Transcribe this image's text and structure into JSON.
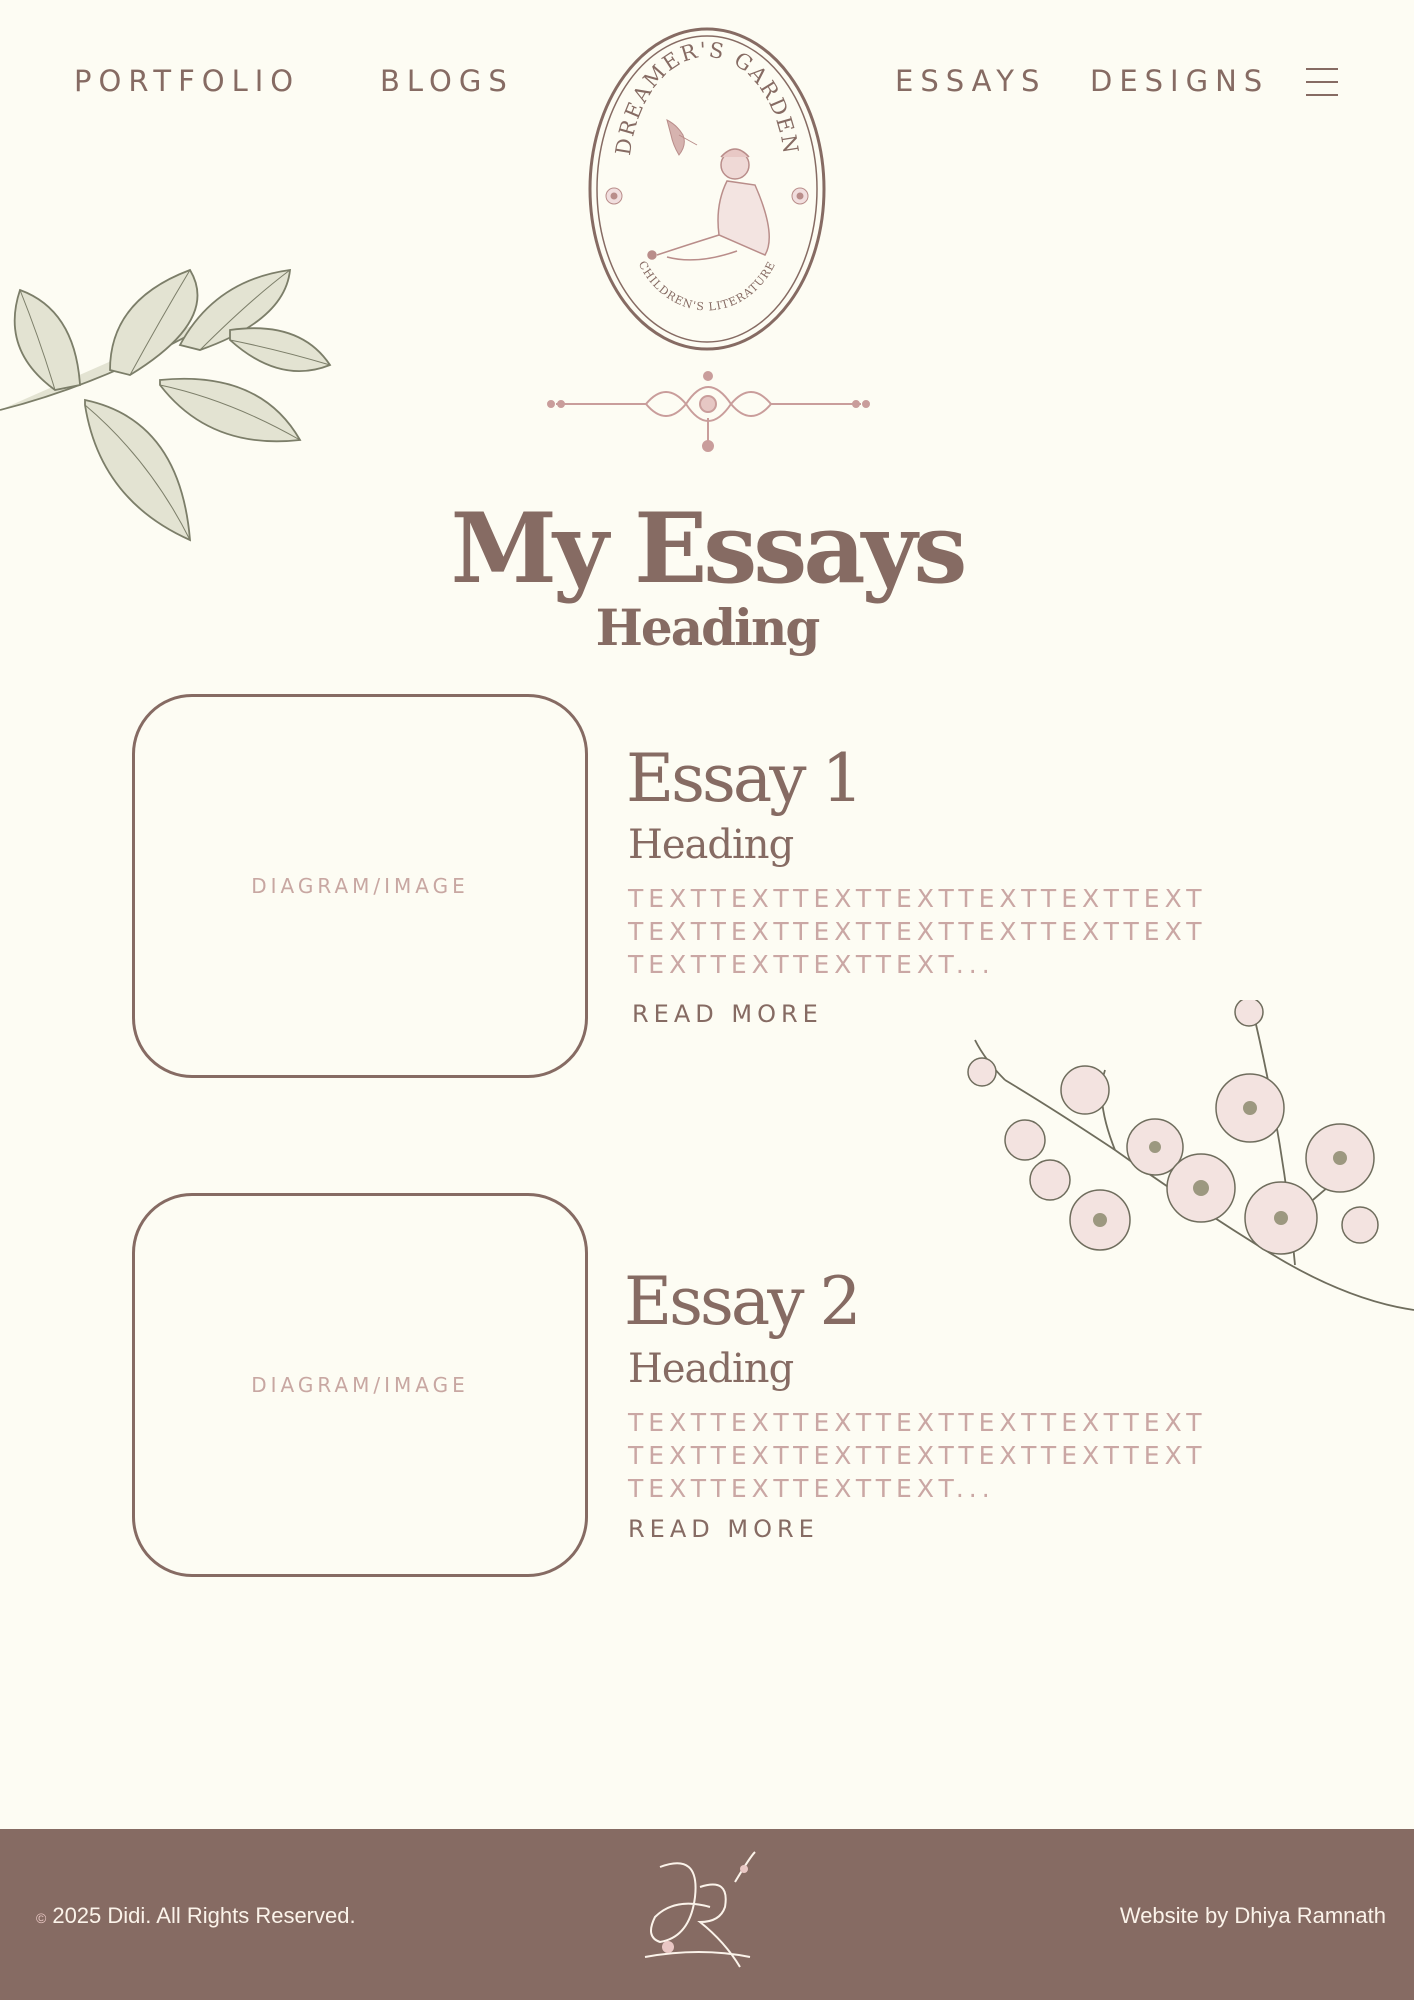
{
  "nav": {
    "left": [
      "PORTFOLIO",
      "BLOGS"
    ],
    "right": [
      "ESSAYS",
      "DESIGNS"
    ],
    "menu_icon": "hamburger-menu-icon"
  },
  "logo": {
    "top_text": "DREAMER'S GARDEN",
    "bottom_text": "CHILDREN'S LITERATURE"
  },
  "page": {
    "title": "My Essays",
    "subtitle": "Heading"
  },
  "essays": [
    {
      "image_placeholder": "DIAGRAM/IMAGE",
      "title": "Essay 1",
      "heading": "Heading",
      "text": "TEXTTEXTTEXTTEXTTEXTTEXTTEXT TEXTTEXTTEXTTEXTTEXTTEXTTEXT TEXTTEXTTEXTTEXT...",
      "read_more": "READ MORE"
    },
    {
      "image_placeholder": "DIAGRAM/IMAGE",
      "title": "Essay 2",
      "heading": "Heading",
      "text": "TEXTTEXTTEXTTEXTTEXTTEXTTEXT TEXTTEXTTEXTTEXTTEXTTEXTTEXT TEXTTEXTTEXTTEXT...",
      "read_more": "READ MORE"
    }
  ],
  "footer": {
    "copyright_symbol": "©",
    "copyright": "2025 Didi. All Rights Reserved.",
    "credit": "Website by Dhiya Ramnath",
    "monogram": "DR"
  },
  "colors": {
    "background": "#fdfcf3",
    "primary": "#866b63",
    "accent_pink": "#caa7a4",
    "footer_bg": "#866b63",
    "footer_text": "#fbf3ea"
  }
}
